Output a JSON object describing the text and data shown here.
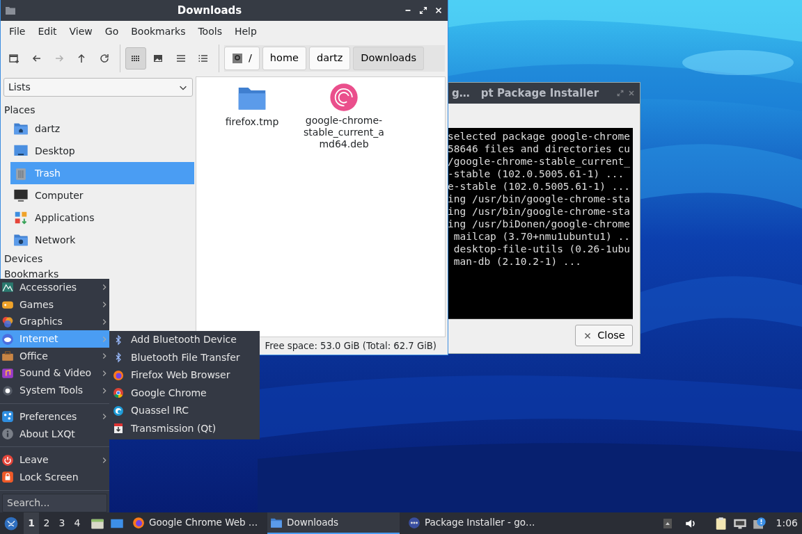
{
  "file_manager": {
    "title": "Downloads",
    "active": true,
    "menu": [
      "File",
      "Edit",
      "View",
      "Go",
      "Bookmarks",
      "Tools",
      "Help"
    ],
    "nav_buttons": [
      {
        "disabled": false
      },
      {
        "disabled": false
      },
      {
        "disabled": true
      },
      {
        "disabled": false
      },
      {
        "disabled": false
      }
    ],
    "view_modes": [
      {
        "selected": true
      },
      {
        "selected": false
      },
      {
        "selected": false
      },
      {
        "selected": false
      }
    ],
    "path": [
      {
        "label": "/",
        "selected": false
      },
      {
        "label": "home",
        "selected": false
      },
      {
        "label": "dartz",
        "selected": false
      },
      {
        "label": "Downloads",
        "selected": true
      }
    ],
    "sidebar": {
      "dropdown": "Lists",
      "sections": [
        {
          "title": "Places",
          "items": [
            {
              "label": "dartz",
              "selected": false
            },
            {
              "label": "Desktop",
              "selected": false
            },
            {
              "label": "Trash",
              "selected": true
            },
            {
              "label": "Computer",
              "selected": false
            },
            {
              "label": "Applications",
              "selected": false
            },
            {
              "label": "Network",
              "selected": false
            }
          ]
        },
        {
          "title": "Devices"
        },
        {
          "title": "Bookmarks"
        }
      ]
    },
    "files": [
      {
        "name": "firefox.tmp",
        "kind": "folder"
      },
      {
        "name": "google-chrome-stable_current_amd64.deb",
        "kind": "package"
      }
    ],
    "status": "Free space: 53.0 GiB (Total: 62.7 GiB)"
  },
  "installer": {
    "title_parts": [
      "g…",
      "pt Package Installer"
    ],
    "active": false,
    "terminal_lines": [
      "selected package google-chrome",
      "58646 files and directories cu",
      "/google-chrome-stable_current_",
      "-stable (102.0.5005.61-1) ...",
      "e-stable (102.0.5005.61-1) ...",
      "ing /usr/bin/google-chrome-sta",
      "ing /usr/bin/google-chrome-sta",
      "ing /usr/biDonen/google-chrome",
      " mailcap (3.70+nmu1ubuntu1) ..",
      " desktop-file-utils (0.26-1ubu",
      " man-db (2.10.2-1) ..."
    ],
    "close_button": "Close"
  },
  "start_menu": {
    "groups": [
      [
        {
          "label": "Accessories",
          "submenu": true,
          "selected": false
        },
        {
          "label": "Games",
          "submenu": true,
          "selected": false
        },
        {
          "label": "Graphics",
          "submenu": true,
          "selected": false
        },
        {
          "label": "Internet",
          "submenu": true,
          "selected": true
        },
        {
          "label": "Office",
          "submenu": true,
          "selected": false
        },
        {
          "label": "Sound & Video",
          "submenu": true,
          "selected": false
        },
        {
          "label": "System Tools",
          "submenu": true,
          "selected": false
        }
      ],
      [
        {
          "label": "Preferences",
          "submenu": true,
          "selected": false
        },
        {
          "label": "About LXQt",
          "submenu": false,
          "selected": false
        }
      ],
      [
        {
          "label": "Leave",
          "submenu": true,
          "selected": false
        },
        {
          "label": "Lock Screen",
          "submenu": false,
          "selected": false
        }
      ]
    ],
    "search": {
      "placeholder": "Search..."
    }
  },
  "submenu": {
    "items": [
      {
        "label": "Add Bluetooth Device"
      },
      {
        "label": "Bluetooth File Transfer"
      },
      {
        "label": "Firefox Web Browser"
      },
      {
        "label": "Google Chrome"
      },
      {
        "label": "Quassel IRC"
      },
      {
        "label": "Transmission (Qt)"
      }
    ]
  },
  "taskbar": {
    "desktops": [
      {
        "label": "1",
        "selected": true
      },
      {
        "label": "2",
        "selected": false
      },
      {
        "label": "3",
        "selected": false
      },
      {
        "label": "4",
        "selected": false
      }
    ],
    "tasks": [
      {
        "label": "Google Chrome Web …",
        "selected": false
      },
      {
        "label": "Downloads",
        "selected": true
      },
      {
        "label": "Package Installer - go…",
        "selected": false
      }
    ],
    "clock": "1:06"
  }
}
